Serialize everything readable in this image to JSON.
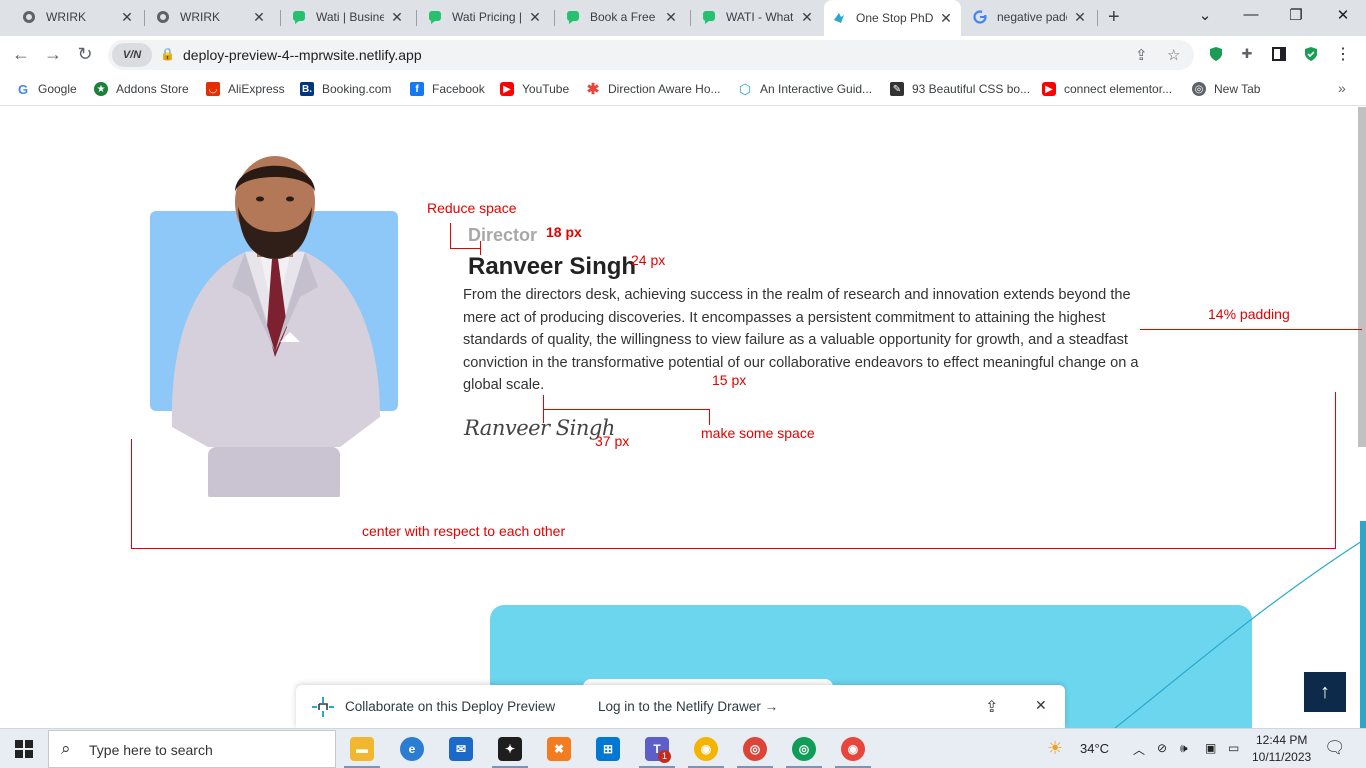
{
  "browser": {
    "tabs": [
      {
        "title": "WRIRK",
        "icon": "globe-icon"
      },
      {
        "title": "WRIRK",
        "icon": "globe-icon"
      },
      {
        "title": "Wati | Business",
        "icon": "chat-bubble-icon"
      },
      {
        "title": "Wati Pricing | ",
        "icon": "chat-bubble-icon"
      },
      {
        "title": "Book a Free D",
        "icon": "chat-bubble-icon"
      },
      {
        "title": "WATI - WhatsA",
        "icon": "chat-bubble-icon"
      },
      {
        "title": "One Stop PhD",
        "icon": "netlify-icon",
        "active": true
      },
      {
        "title": "negative padd",
        "icon": "google-icon"
      }
    ],
    "url": "deploy-preview-4--mprwsite.netlify.app",
    "vpn_label": "V/N",
    "bookmarks": [
      {
        "label": "Google",
        "icon": "google-icon",
        "color": "#4285f4"
      },
      {
        "label": "Addons Store",
        "icon": "addons-icon",
        "color": "#1a7f37"
      },
      {
        "label": "AliExpress",
        "icon": "aliexpress-icon",
        "color": "#e62e04"
      },
      {
        "label": "Booking.com",
        "icon": "booking-icon",
        "color": "#003580"
      },
      {
        "label": "Facebook",
        "icon": "facebook-icon",
        "color": "#1877f2"
      },
      {
        "label": "YouTube",
        "icon": "youtube-icon",
        "color": "#ff0000"
      },
      {
        "label": "Direction Aware Ho...",
        "icon": "asterisk-icon",
        "color": "#e8453c"
      },
      {
        "label": "An Interactive Guid...",
        "icon": "cube-icon",
        "color": "#2aa8c9"
      },
      {
        "label": "93 Beautiful CSS bo...",
        "icon": "css-icon",
        "color": "#333333"
      },
      {
        "label": "connect elementor...",
        "icon": "youtube-icon",
        "color": "#ff0000"
      },
      {
        "label": "New Tab",
        "icon": "globe-icon",
        "color": "#5f6368"
      }
    ]
  },
  "content": {
    "role": "Director",
    "name": "Ranveer Singh",
    "description": "From the directors desk, achieving success in the realm of research and innovation extends beyond the mere act of producing discoveries. It encompasses a persistent commitment to attaining the highest standards of quality, the willingness to view failure as a valuable opportunity for growth, and a steadfast conviction in the transformative potential of our collaborative endeavors to effect meaningful change on a global scale.",
    "signature": "Ranveer Singh"
  },
  "annotations": {
    "reduce_space": "Reduce space",
    "role_size": "18 px",
    "name_size": "24 px",
    "desc_size": "15 px",
    "sig_size": "37 px",
    "make_space": "make some space",
    "padding": "14% padding",
    "center": "center with respect to each other"
  },
  "netlify": {
    "collaborate": "Collaborate on this Deploy Preview",
    "login": "Log in to the Netlify Drawer"
  },
  "taskbar": {
    "search_placeholder": "Type here to search",
    "temperature": "34°C",
    "time": "12:44 PM",
    "date": "10/11/2023",
    "teams_badge": "1"
  }
}
